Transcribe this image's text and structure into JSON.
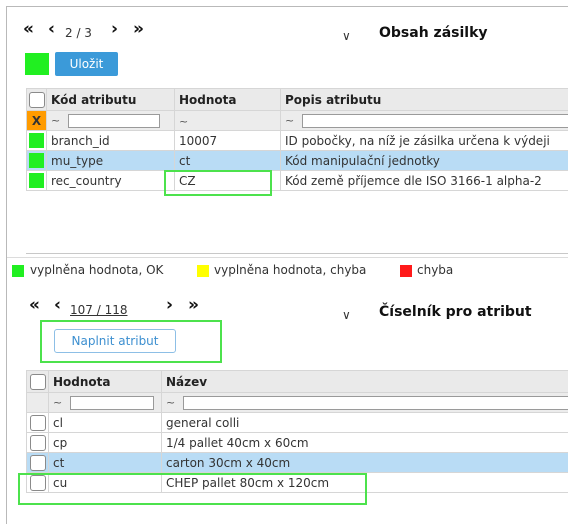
{
  "top": {
    "pager": {
      "first": "«",
      "prev": "‹",
      "text": "2 / 3",
      "next": "›",
      "last": "»"
    },
    "chevron": "∨",
    "title": "Obsah zásilky",
    "save_label": "Uložit",
    "table": {
      "headers": [
        "Kód atributu",
        "Hodnota",
        "Popis atributu"
      ],
      "filter_tilde": "~",
      "status_marker": "X",
      "rows": [
        {
          "code": "branch_id",
          "value": "10007",
          "desc": "ID pobočky, na níž je zásilka určena k výdeji"
        },
        {
          "code": "mu_type",
          "value": "ct",
          "desc": "Kód manipulační jednotky"
        },
        {
          "code": "rec_country",
          "value": "CZ",
          "desc": "Kód země příjemce dle ISO 3166-1 alpha-2"
        }
      ]
    }
  },
  "legend": [
    {
      "color": "#21ef21",
      "label": "vyplněna hodnota, OK"
    },
    {
      "color": "#ffff00",
      "label": "vyplněna hodnota, chyba"
    },
    {
      "color": "#ff1a1a",
      "label": "chyba"
    }
  ],
  "bottom": {
    "pager": {
      "first": "«",
      "prev": "‹",
      "text": "107 / 118",
      "next": "›",
      "last": "»"
    },
    "chevron": "∨",
    "title": "Číselník pro atribut",
    "fill_label": "Naplnit atribut",
    "table": {
      "headers": [
        "Hodnota",
        "Název"
      ],
      "filter_tilde": "~",
      "rows": [
        {
          "value": "cl",
          "name": "general colli"
        },
        {
          "value": "cp",
          "name": "1/4 pallet 40cm x 60cm"
        },
        {
          "value": "ct",
          "name": "carton 30cm x 40cm"
        },
        {
          "value": "cu",
          "name": "CHEP pallet 80cm x 120cm"
        }
      ]
    }
  }
}
